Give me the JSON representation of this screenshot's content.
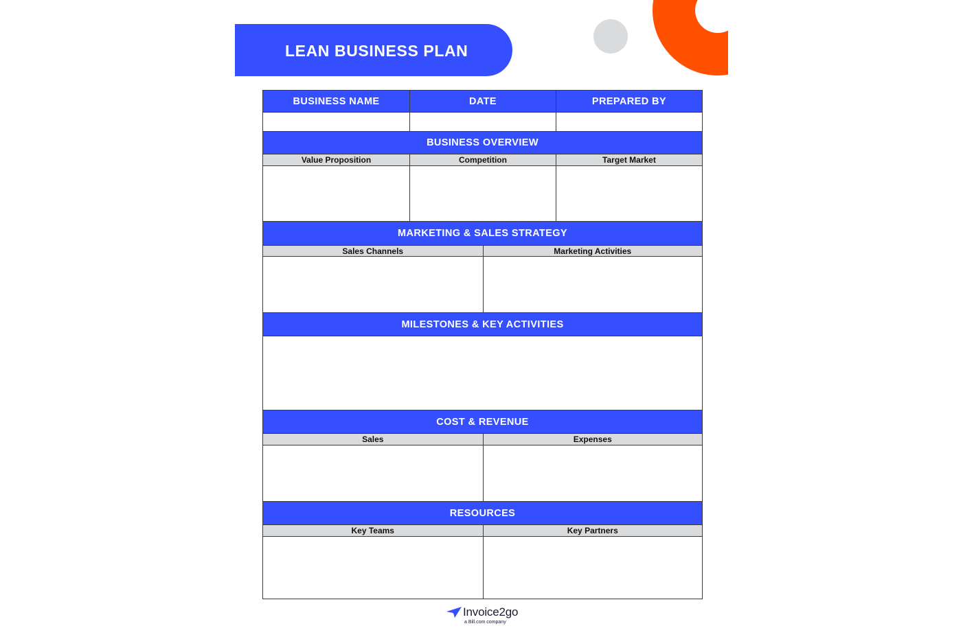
{
  "document": {
    "title": "LEAN BUSINESS PLAN",
    "colors": {
      "primary_blue": "#364ffe",
      "accent_orange": "#ff5000",
      "decor_grey": "#d9dbdc",
      "subheader_grey": "#d9dbdc"
    }
  },
  "header_row": {
    "columns": [
      "BUSINESS NAME",
      "DATE",
      "PREPARED BY"
    ],
    "values": [
      "",
      "",
      ""
    ]
  },
  "sections": [
    {
      "title": "BUSINESS OVERVIEW",
      "subheaders": [
        "Value Proposition",
        "Competition",
        "Target Market"
      ],
      "values": [
        "",
        "",
        ""
      ]
    },
    {
      "title": "MARKETING & SALES STRATEGY",
      "subheaders": [
        "Sales Channels",
        "Marketing Activities"
      ],
      "values": [
        "",
        ""
      ]
    },
    {
      "title": "MILESTONES & KEY ACTIVITIES",
      "subheaders": [],
      "values": [
        ""
      ]
    },
    {
      "title": "COST & REVENUE",
      "subheaders": [
        "Sales",
        "Expenses"
      ],
      "values": [
        "",
        ""
      ]
    },
    {
      "title": "RESOURCES",
      "subheaders": [
        "Key Teams",
        "Key Partners"
      ],
      "values": [
        "",
        ""
      ]
    }
  ],
  "footer": {
    "logo_icon": "paper-plane-icon",
    "brand": "Invoice2go",
    "tagline": "a Bill.com company"
  }
}
